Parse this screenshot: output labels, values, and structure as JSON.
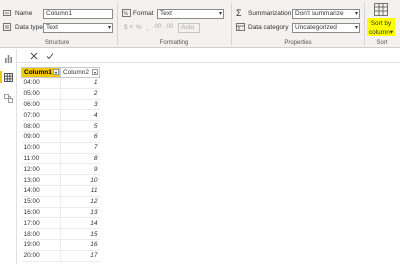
{
  "ribbon": {
    "structure": {
      "name_label": "Name",
      "name_value": "Column1",
      "datatype_label": "Data type",
      "datatype_value": "Text",
      "group_label": "Structure"
    },
    "formatting": {
      "format_label": "Format",
      "format_value": "Text",
      "currency_symbol": "$",
      "percent_symbol": "%",
      "comma_symbol": ",",
      "decimals_symbol": ".00",
      "auto_value": "Auto",
      "group_label": "Formatting"
    },
    "properties": {
      "summarization_label": "Summarization",
      "summarization_value": "Don't summarize",
      "datacategory_label": "Data category",
      "datacategory_value": "Uncategorized",
      "group_label": "Properties"
    },
    "sort": {
      "button_label_line1": "Sort by",
      "button_label_line2": "column",
      "group_label": "Sort"
    }
  },
  "accent_color": "#f2c811",
  "highlight_color": "#ffff00",
  "formula_bar": {
    "cancel_icon": "close-icon",
    "commit_icon": "check-icon"
  },
  "left_nav": [
    "report-view-icon",
    "data-view-icon",
    "model-view-icon"
  ],
  "table": {
    "columns": [
      "Column1",
      "Column2"
    ],
    "rows": [
      [
        "04:00",
        "1"
      ],
      [
        "05:00",
        "2"
      ],
      [
        "06:00",
        "3"
      ],
      [
        "07:00",
        "4"
      ],
      [
        "08:00",
        "5"
      ],
      [
        "09:00",
        "6"
      ],
      [
        "10:00",
        "7"
      ],
      [
        "11:00",
        "8"
      ],
      [
        "12:00",
        "9"
      ],
      [
        "13:00",
        "10"
      ],
      [
        "14:00",
        "11"
      ],
      [
        "15:00",
        "12"
      ],
      [
        "16:00",
        "13"
      ],
      [
        "17:00",
        "14"
      ],
      [
        "18:00",
        "15"
      ],
      [
        "19:00",
        "16"
      ],
      [
        "20:00",
        "17"
      ]
    ]
  }
}
